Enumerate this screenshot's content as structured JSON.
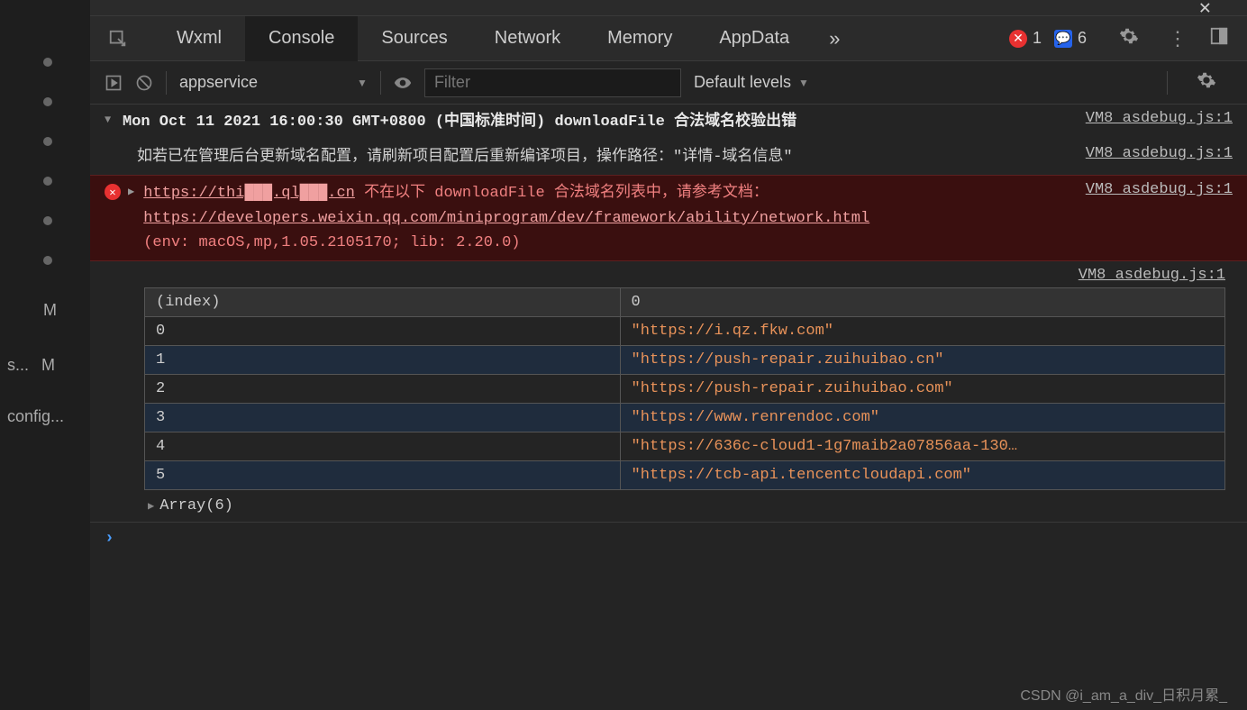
{
  "sidebar": {
    "m1": "M",
    "m2": "M",
    "s": "s...",
    "config": "config..."
  },
  "tabs": {
    "wxml": "Wxml",
    "console": "Console",
    "sources": "Sources",
    "network": "Network",
    "memory": "Memory",
    "appdata": "AppData",
    "more": "»",
    "err_count": "1",
    "info_count": "6"
  },
  "toolbar": {
    "context": "appservice",
    "filter_placeholder": "Filter",
    "levels": "Default levels"
  },
  "logs": {
    "header": "Mon Oct 11 2021 16:00:30 GMT+0800 (中国标准时间) downloadFile 合法域名校验出错",
    "header_src": "VM8 asdebug.js:1",
    "info": "如若已在管理后台更新域名配置，请刷新项目配置后重新编译项目，操作路径：\"详情-域名信息\"",
    "info_src": "VM8 asdebug.js:1",
    "error": {
      "url_masked": "https://thi███.ql███.cn",
      "msg1": " 不在以下 downloadFile 合法域名列表中，请参考文档：",
      "doc_url": "https://developers.weixin.qq.com/miniprogram/dev/framework/ability/network.html",
      "env": "(env: macOS,mp,1.05.2105170; lib: 2.20.0)",
      "src": "VM8 asdebug.js:1"
    },
    "table_src": "VM8 asdebug.js:1",
    "table": {
      "col0": "(index)",
      "col1": "0",
      "rows": [
        {
          "idx": "0",
          "val": "\"https://i.qz.fkw.com\""
        },
        {
          "idx": "1",
          "val": "\"https://push-repair.zuihuibao.cn\""
        },
        {
          "idx": "2",
          "val": "\"https://push-repair.zuihuibao.com\""
        },
        {
          "idx": "3",
          "val": "\"https://www.renrendoc.com\""
        },
        {
          "idx": "4",
          "val": "\"https://636c-cloud1-1g7maib2a07856aa-130…"
        },
        {
          "idx": "5",
          "val": "\"https://tcb-api.tencentcloudapi.com\""
        }
      ]
    },
    "array_label": "Array(6)"
  },
  "watermark": "CSDN @i_am_a_div_日积月累_"
}
